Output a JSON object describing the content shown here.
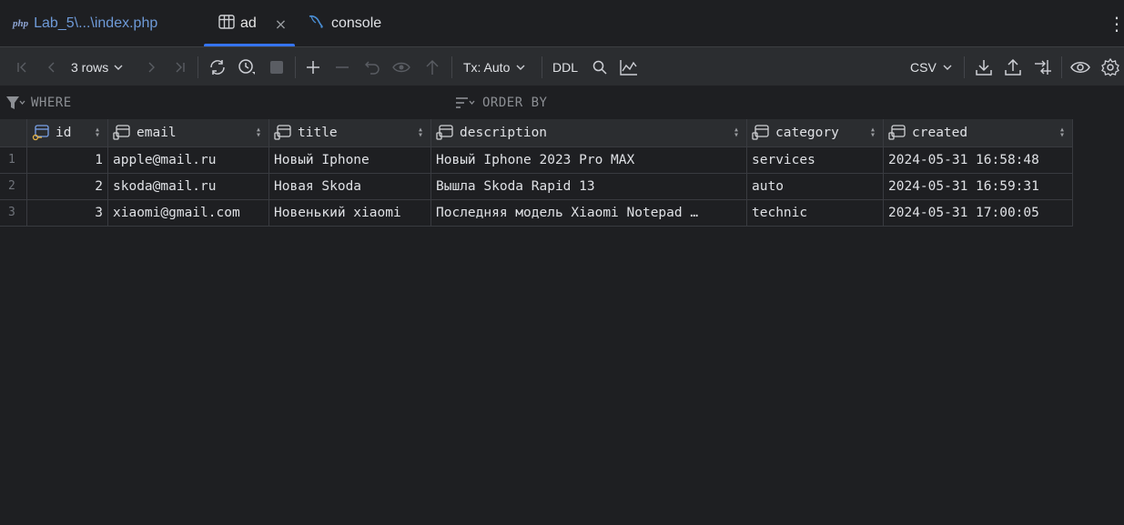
{
  "tabs": {
    "php_icon": "php",
    "php_label": "Lab_5\\...\\index.php",
    "ad_label": "ad",
    "ad_close": "×",
    "console_label": "console",
    "kebab": "⋮"
  },
  "toolbar": {
    "rows_label": "3 rows",
    "tx_label": "Tx: Auto",
    "ddl_label": "DDL",
    "csv_label": "CSV"
  },
  "filter": {
    "where_label": "WHERE",
    "order_label": "ORDER BY"
  },
  "table": {
    "columns": [
      "id",
      "email",
      "title",
      "description",
      "category",
      "created"
    ],
    "rows": [
      {
        "n": "1",
        "id": "1",
        "email": "apple@mail.ru",
        "title": "Новый Iphone",
        "description": "Новый Iphone 2023 Pro MAX",
        "category": "services",
        "created": "2024-05-31 16:58:48"
      },
      {
        "n": "2",
        "id": "2",
        "email": "skoda@mail.ru",
        "title": "Новая Skoda",
        "description": "Вышла Skoda Rapid 13",
        "category": "auto",
        "created": "2024-05-31 16:59:31"
      },
      {
        "n": "3",
        "id": "3",
        "email": "xiaomi@gmail.com",
        "title": "Новенький xiaomi",
        "description": "Последняя модель Xiaomi Notepad …",
        "category": "technic",
        "created": "2024-05-31 17:00:05"
      }
    ]
  },
  "colors": {
    "accent": "#3574f0",
    "background": "#1e1f22",
    "toolbar": "#2b2d30"
  }
}
